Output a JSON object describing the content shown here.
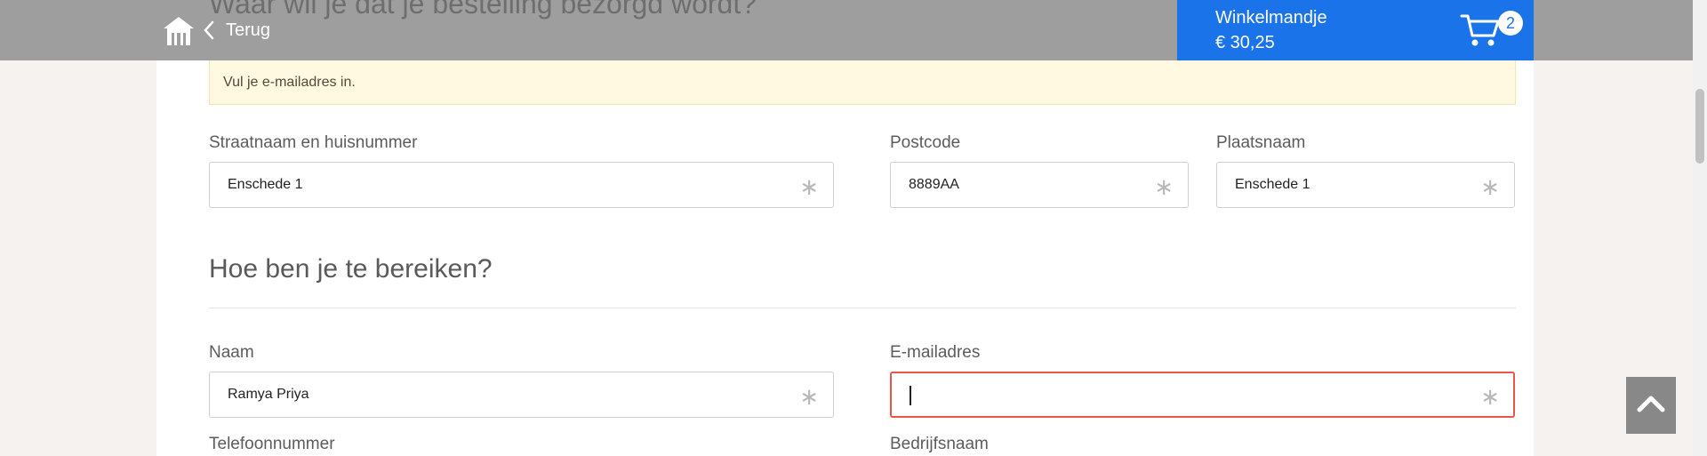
{
  "header": {
    "partial_heading": "Waar wil je dat je bestelling bezorgd wordt?",
    "back_label": "Terug",
    "basket_title": "Winkelmandje",
    "basket_total": "€ 30,25",
    "basket_count": "2",
    "icons": {
      "logo": "home-logo-icon",
      "back": "chevron-left-icon",
      "cart": "cart-icon"
    }
  },
  "notice": {
    "text": "Vul je e-mailadres in."
  },
  "address": {
    "street_label": "Straatnaam en huisnummer",
    "street_value": "Enschede 1",
    "postcode_label": "Postcode",
    "postcode_value": "8889AA",
    "city_label": "Plaatsnaam",
    "city_value": "Enschede 1"
  },
  "contact": {
    "heading": "Hoe ben je te bereiken?",
    "name_label": "Naam",
    "name_value": "Ramya Priya",
    "email_label": "E-mailadres",
    "email_value": "",
    "phone_label": "Telefoonnummer",
    "company_label": "Bedrijfsnaam"
  },
  "required_mark": "∗",
  "colors": {
    "accent": "#1a73e8",
    "error": "#e8564a",
    "notice_bg": "#fff9e1",
    "header_bg": "#9e9e9e"
  }
}
